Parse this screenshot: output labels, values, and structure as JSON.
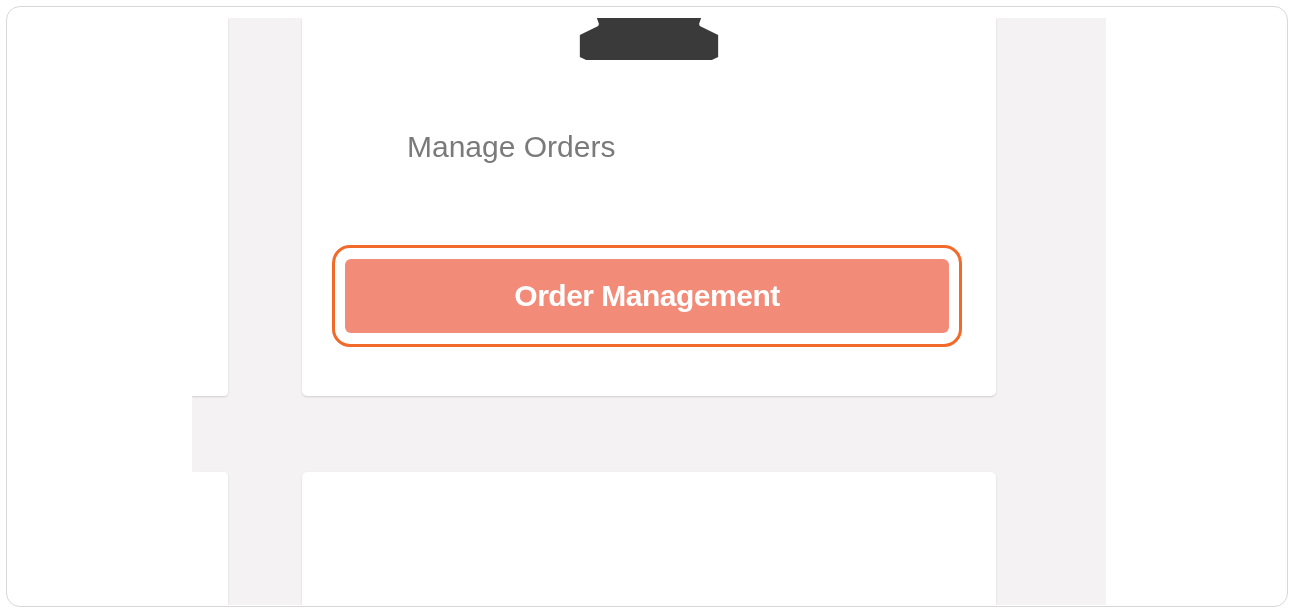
{
  "card": {
    "description": "Manage Orders",
    "button": {
      "label": "Order Management",
      "highlighted": true
    }
  }
}
